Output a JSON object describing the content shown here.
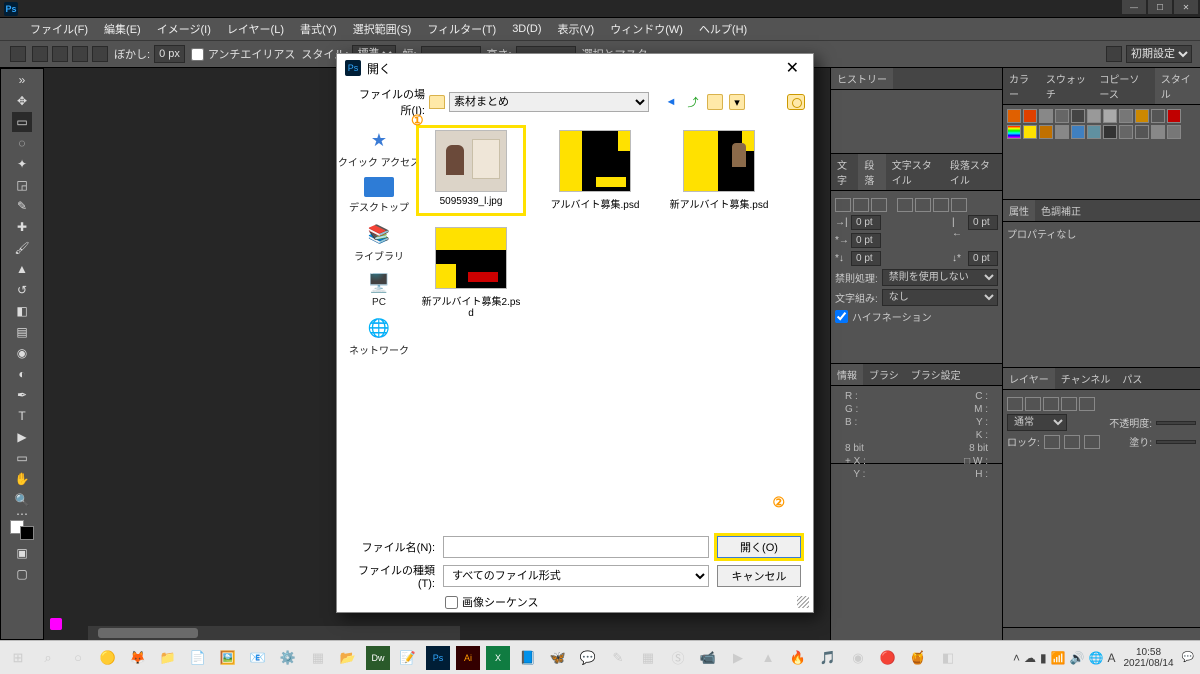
{
  "app": {
    "logo": "Ps"
  },
  "menubar": [
    "ファイル(F)",
    "編集(E)",
    "イメージ(I)",
    "レイヤー(L)",
    "書式(Y)",
    "選択範囲(S)",
    "フィルター(T)",
    "3D(D)",
    "表示(V)",
    "ウィンドウ(W)",
    "ヘルプ(H)"
  ],
  "optbar": {
    "feather_label": "ぼかし:",
    "feather_value": "0 px",
    "antialias": "アンチエイリアス",
    "style_label": "スタイル:",
    "style_value": "標準",
    "width_label": "幅:",
    "height_label": "高さ:",
    "refine": "選択とマスク...",
    "workspace": "初期設定"
  },
  "panels": {
    "history_tab": "ヒストリー",
    "paragraph_tabs": [
      "文字",
      "段落",
      "文字スタイル",
      "段落スタイル"
    ],
    "paragraph": {
      "left": "0 pt",
      "right": "0 pt",
      "first": "0 pt",
      "before": "0 pt",
      "after": "0 pt",
      "kinsoku_label": "禁則処理:",
      "kinsoku_value": "禁則を使用しない",
      "moji_label": "文字組み:",
      "moji_value": "なし",
      "hyphen": "ハイフネーション"
    },
    "swatch_tabs": [
      "カラー",
      "スウォッチ",
      "コピーソース",
      "スタイル"
    ],
    "props_tabs": [
      "属性",
      "色調補正"
    ],
    "props_body": "プロパティなし",
    "info_tabs": [
      "情報",
      "ブラシ",
      "ブラシ設定"
    ],
    "info": {
      "R": "R :",
      "G": "G :",
      "B": "B :",
      "C": "C :",
      "M": "M :",
      "Y": "Y :",
      "K": "K :",
      "bits": "8 bit",
      "X": "X :",
      "Y2": "Y :",
      "W": "W :",
      "H": "H :"
    },
    "layer_tabs": [
      "レイヤー",
      "チャンネル",
      "パス"
    ],
    "layer": {
      "blend": "通常",
      "opacity_label": "不透明度:",
      "lock_label": "ロック:",
      "fill_label": "塗り:"
    }
  },
  "dialog": {
    "title": "開く",
    "location_label": "ファイルの場所(I):",
    "location_value": "素材まとめ",
    "places": [
      {
        "label": "クイック アクセス"
      },
      {
        "label": "デスクトップ"
      },
      {
        "label": "ライブラリ"
      },
      {
        "label": "PC"
      },
      {
        "label": "ネットワーク"
      }
    ],
    "files": [
      {
        "name": "5095939_l.jpg",
        "selected": true,
        "kind": "photo"
      },
      {
        "name": "アルバイト募集.psd",
        "kind": "poster"
      },
      {
        "name": "新アルバイト募集.psd",
        "kind": "poster"
      },
      {
        "name": "新アルバイト募集2.psd",
        "kind": "poster"
      }
    ],
    "annot1": "①",
    "annot2": "②",
    "filename_label": "ファイル名(N):",
    "filetype_label": "ファイルの種類(T):",
    "filetype_value": "すべてのファイル形式",
    "open_btn": "開く(O)",
    "cancel_btn": "キャンセル",
    "sequence": "画像シーケンス"
  },
  "taskbar": {
    "time": "10:58",
    "date": "2021/08/14"
  }
}
